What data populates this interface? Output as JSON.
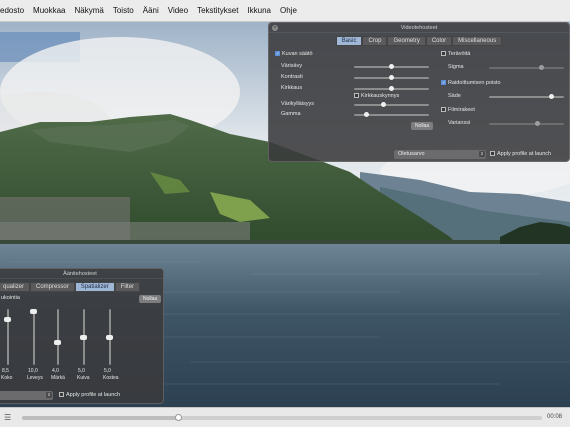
{
  "menu": {
    "items": [
      "edosto",
      "Muokkaa",
      "Näkymä",
      "Toisto",
      "Ääni",
      "Video",
      "Tekstitykset",
      "Ikkuna",
      "Ohje"
    ]
  },
  "video_effects": {
    "title": "Videotehosteet",
    "tabs": [
      "Basic",
      "Crop",
      "Geometry",
      "Color",
      "Miscellaneous"
    ],
    "active_tab": "Basic",
    "image_adjust": {
      "label": "Kuvan säätö",
      "checked": true,
      "hue_label": "Värisävy",
      "hue_value": 0.5,
      "contrast_label": "Kontrasti",
      "contrast_value": 0.5,
      "brightness_label": "Kirkkaus",
      "brightness_value": 0.5,
      "brightness_threshold_label": "Kirkkauskynnys",
      "brightness_threshold_checked": false,
      "saturation_label": "Värikylläisyys",
      "saturation_value": 0.38,
      "gamma_label": "Gamma",
      "gamma_value": 0.14,
      "reset_label": "Nollaa"
    },
    "sharpen": {
      "label": "Terävöitä",
      "checked": false,
      "sigma_label": "Sigma",
      "sigma_value": 0.71
    },
    "banding": {
      "label": "Raidoittumisen poisto",
      "checked": true,
      "radius_label": "Säde",
      "radius_value": 0.85
    },
    "grain": {
      "label": "Filmirakeet",
      "checked": false,
      "variance_label": "Varianssi",
      "variance_value": 0.65
    },
    "profile_select": "Oletusarvo",
    "apply_profile_label": "Apply profile at launch",
    "apply_profile_checked": false
  },
  "audio_effects": {
    "title": "Äänitehosteet",
    "tabs": [
      "qualizer",
      "Compressor",
      "Spatializer",
      "Filter"
    ],
    "active_tab": "Spatializer",
    "enable_label": "ukointia",
    "enable_checked": true,
    "reset_label": "Nollaa",
    "bands": [
      {
        "label": "Koko",
        "value_text": "8,5",
        "level": 0.85
      },
      {
        "label": "Leveys",
        "value_text": "10,0",
        "level": 1.0
      },
      {
        "label": "Märkä",
        "value_text": "4,0",
        "level": 0.4
      },
      {
        "label": "Kuiva",
        "value_text": "5,0",
        "level": 0.5
      },
      {
        "label": "Kostea",
        "value_text": "5,0",
        "level": 0.5
      }
    ],
    "apply_profile_label": "Apply profile at launch",
    "apply_profile_checked": false
  },
  "controls": {
    "timecode": "00:08",
    "progress": 0.3
  }
}
